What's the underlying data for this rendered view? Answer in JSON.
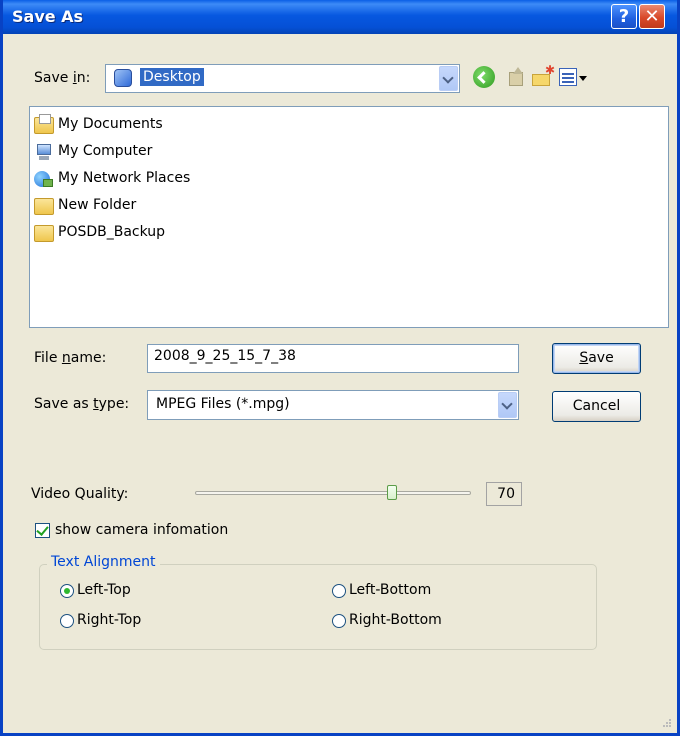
{
  "window": {
    "title": "Save As"
  },
  "icons": {
    "help": "help-icon",
    "close": "close-icon",
    "back": "back-arrow-icon",
    "up": "up-folder-icon",
    "new_folder": "new-folder-icon",
    "view": "view-menu-icon"
  },
  "save_in": {
    "label_pre": "Save ",
    "label_key": "i",
    "label_post": "n:",
    "value": "Desktop"
  },
  "files": [
    {
      "name": "My Documents",
      "icon": "my-documents-icon"
    },
    {
      "name": "My Computer",
      "icon": "my-computer-icon"
    },
    {
      "name": "My Network Places",
      "icon": "network-places-icon"
    },
    {
      "name": "New Folder",
      "icon": "folder-icon"
    },
    {
      "name": "POSDB_Backup",
      "icon": "folder-icon"
    }
  ],
  "file_name": {
    "label_pre": "File ",
    "label_key": "n",
    "label_post": "ame:",
    "value": "2008_9_25_15_7_38"
  },
  "save_type": {
    "label_pre": "Save as ",
    "label_key": "t",
    "label_post": "ype:",
    "value": "MPEG Files (*.mpg)"
  },
  "buttons": {
    "save_key": "S",
    "save_rest": "ave",
    "cancel": "Cancel"
  },
  "video_quality": {
    "label": "Video Quality:",
    "value": "70",
    "level": 70,
    "max": 100
  },
  "show_camera": {
    "label": "show camera infomation",
    "checked": true
  },
  "text_alignment": {
    "legend": "Text Alignment",
    "options": [
      "Left-Top",
      "Left-Bottom",
      "Right-Top",
      "Right-Bottom"
    ],
    "selected": "Left-Top"
  }
}
